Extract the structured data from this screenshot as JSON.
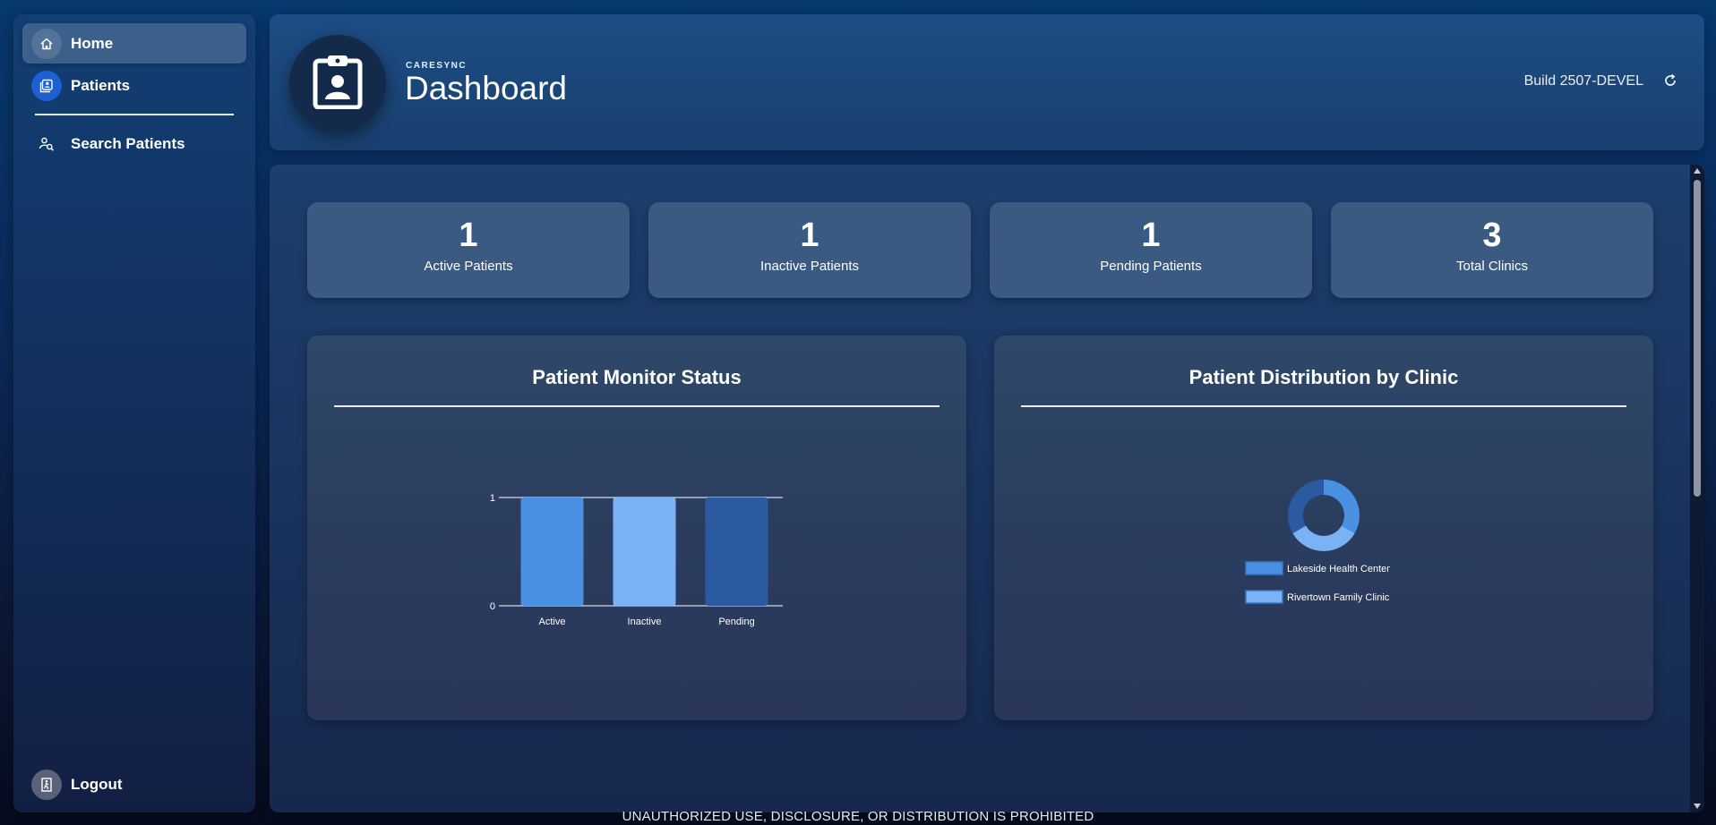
{
  "sidebar": {
    "items": [
      {
        "label": "Home",
        "icon": "home-icon"
      },
      {
        "label": "Patients",
        "icon": "patients-icon"
      },
      {
        "label": "Search Patients",
        "icon": "search-patients-icon"
      }
    ],
    "logout_label": "Logout"
  },
  "header": {
    "brand": "CARESYNC",
    "title": "Dashboard",
    "build": "Build 2507-DEVEL"
  },
  "stats": [
    {
      "value": "1",
      "label": "Active Patients"
    },
    {
      "value": "1",
      "label": "Inactive Patients"
    },
    {
      "value": "1",
      "label": "Pending Patients"
    },
    {
      "value": "3",
      "label": "Total Clinics"
    }
  ],
  "chart_data": [
    {
      "type": "bar",
      "title": "Patient Monitor Status",
      "categories": [
        "Active",
        "Inactive",
        "Pending"
      ],
      "values": [
        1,
        1,
        1
      ],
      "yticks": [
        "0",
        "1"
      ],
      "ylim": [
        0,
        1
      ],
      "grid": true,
      "colors": [
        "#4a90e2",
        "#7ab3f5",
        "#2c5aa0"
      ]
    },
    {
      "type": "pie",
      "title": "Patient Distribution by Clinic",
      "labels": [
        "Lakeside Health Center",
        "Rivertown Family Clinic"
      ],
      "values": [
        1,
        1
      ],
      "extra_segment_value": 1,
      "legend": "bottom",
      "colors": [
        "#4a90e2",
        "#7ab3f5",
        "#2c5aa0"
      ]
    }
  ],
  "footer": {
    "notice": "UNAUTHORIZED USE, DISCLOSURE, OR DISTRIBUTION IS PROHIBITED"
  }
}
